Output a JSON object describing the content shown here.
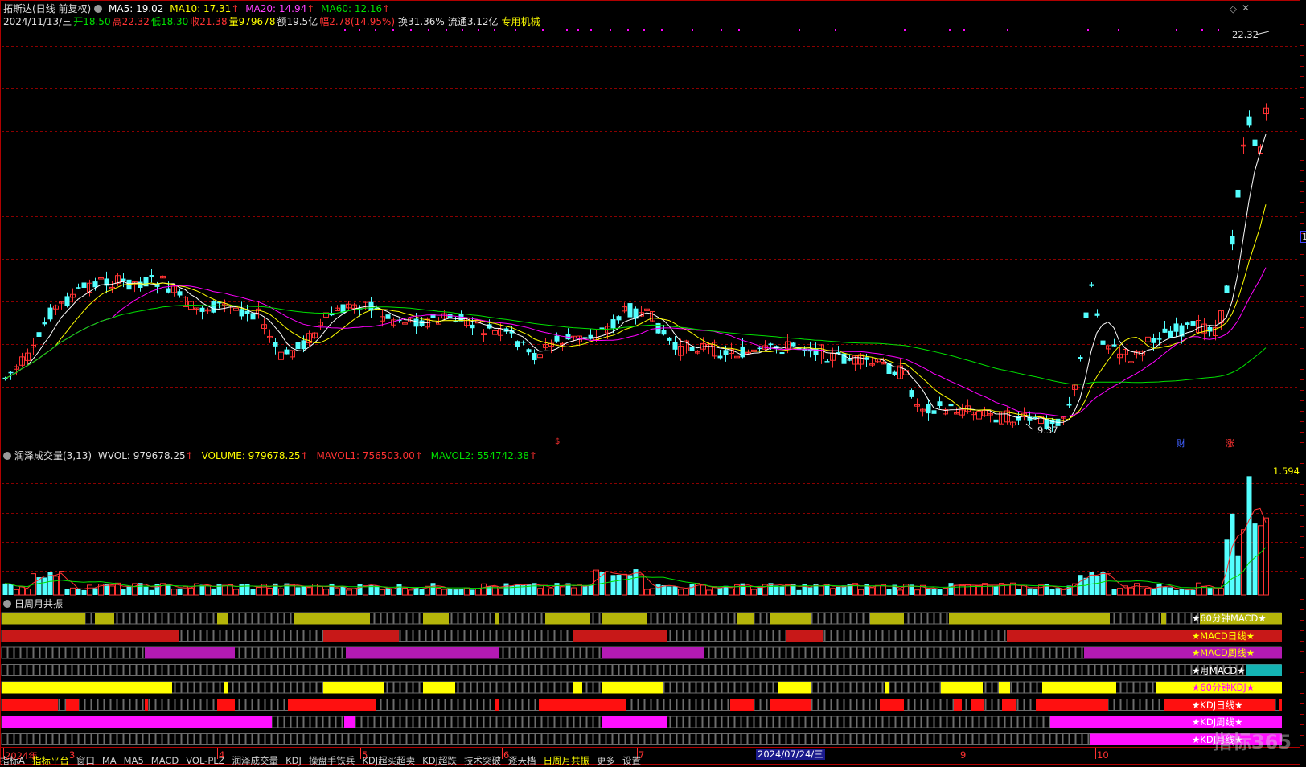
{
  "header": {
    "stock_name": "拓斯达(日线 前复权)",
    "ma5_label": "MA5: 19.02",
    "ma10_label": "MA10: 17.31",
    "ma20_label": "MA20: 14.94",
    "ma60_label": "MA60: 12.16",
    "date": "2024/11/13/三",
    "open": "开18.50",
    "high": "高22.32",
    "low": "低18.30",
    "close": "收21.38",
    "volume": "量979678",
    "amount": "额19.5亿",
    "change": "幅2.78(14.95%)",
    "turnover": "换31.36%",
    "float_cap": "流通3.12亿",
    "sector": "专用机械",
    "arrow": "↑"
  },
  "price_panel": {
    "high_label": "22.32",
    "low_label": "9.37",
    "markers": [
      "$",
      "财",
      "涨"
    ],
    "right_edge_label": "1"
  },
  "volume_panel": {
    "title": "润泽成交量(3,13)",
    "wvol": "WVOL: 979678.25",
    "volume": "VOLUME: 979678.25",
    "mavol1": "MAVOL1: 756503.00",
    "mavol2": "MAVOL2: 554742.38",
    "scale_label": "1.594"
  },
  "resonance_panel": {
    "title": "日周月共振",
    "rows": [
      {
        "label": "★60分钟MACD★",
        "color": "#b5b50a",
        "label_color": "#ffffff"
      },
      {
        "label": "★MACD日线★",
        "color": "#c81818",
        "label_color": "#ffff00"
      },
      {
        "label": "★MACD周线★",
        "color": "#b41ab4",
        "label_color": "#ffff00"
      },
      {
        "label": "★月MACD★",
        "color": "#14b4b4",
        "label_color": "#ffffff"
      },
      {
        "label": "★60分钟KDJ★",
        "color": "#ffff00",
        "label_color": "#ff00ff"
      },
      {
        "label": "★KDJ日线★",
        "color": "#ff1010",
        "label_color": "#ffffff"
      },
      {
        "label": "★KDJ周线★",
        "color": "#ff10ff",
        "label_color": "#ffffff"
      },
      {
        "label": "★KDJ月线★",
        "color": "#ff10ff",
        "label_color": "#ffffff"
      }
    ]
  },
  "time_axis": {
    "labels": [
      "2024年",
      "3",
      "4",
      "5",
      "6",
      "7",
      "9",
      "10"
    ],
    "selected_date": "2024/07/24/三"
  },
  "bottom_tabs": [
    "指标A",
    "指标平台",
    "窗口",
    "MA",
    "MA5",
    "MACD",
    "VOL-PLZ",
    "润泽成交量",
    "KDJ",
    "操盘手铁兵",
    "KDJ超买超卖",
    "KDJ超跌",
    "技术突破",
    "逐天档",
    "日周月共振",
    "更多",
    "设置"
  ],
  "watermark": "指标365",
  "colors": {
    "up": "#ff3232",
    "down": "#54ffff",
    "ma5": "#ffffff",
    "ma10": "#ffff00",
    "ma20": "#ff00ff",
    "ma60": "#00e000",
    "grid": "#8b0000",
    "border": "#b00000"
  }
}
